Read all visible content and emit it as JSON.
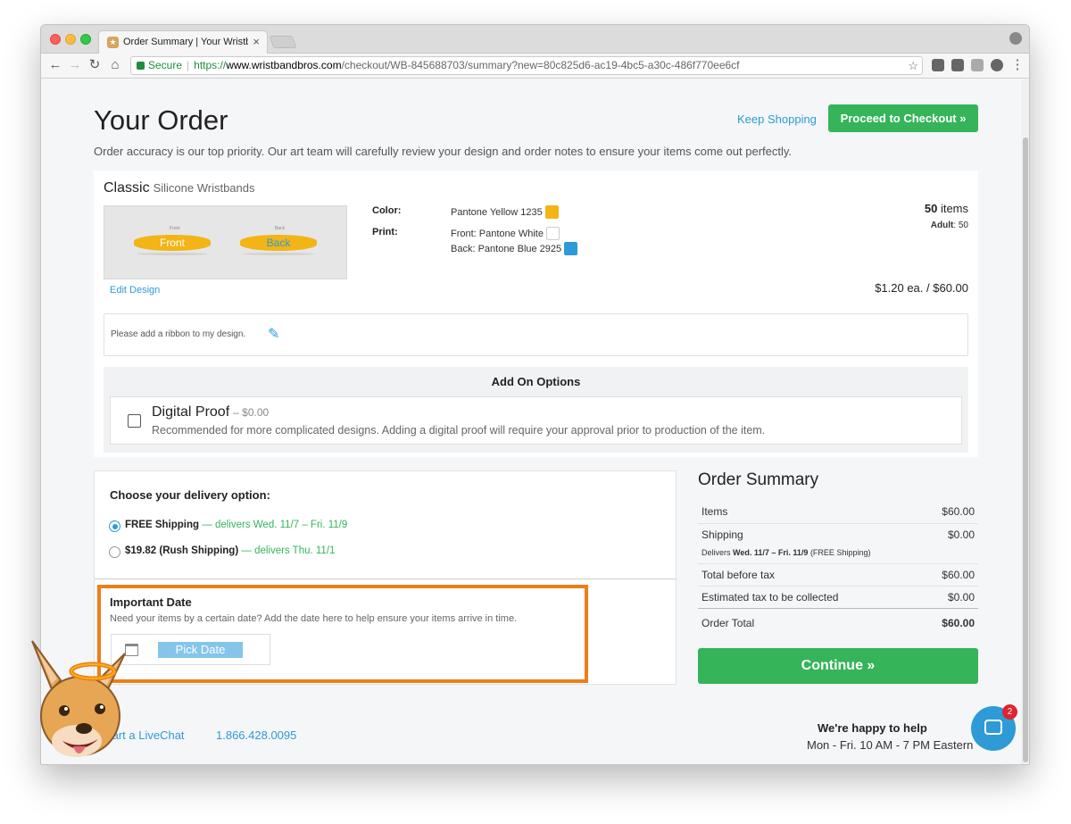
{
  "browser": {
    "tab_title": "Order Summary | Your Wristba",
    "url_secure": "Secure",
    "url_scheme": "https://",
    "url_host": "www.wristbandbros.com",
    "url_path": "/checkout/WB-845688703/summary?new=80c825d6-ac19-4bc5-a30c-486f770ee6cf"
  },
  "header": {
    "title": "Your Order",
    "keep_shopping": "Keep Shopping",
    "proceed": "Proceed to Checkout »",
    "intro": "Order accuracy is our top priority. Our art team will carefully review your design and order notes to ensure your items come out perfectly."
  },
  "product": {
    "name": "Classic",
    "subtitle": "Silicone Wristbands",
    "preview_front": "Front",
    "preview_back": "Back",
    "edit_design": "Edit Design",
    "color_label": "Color:",
    "color_value": "Pantone Yellow 1235",
    "print_label": "Print:",
    "print_front": "Front: Pantone White",
    "print_back": "Back: Pantone Blue 2925",
    "qty_number": "50",
    "qty_unit": "items",
    "adult_label": "Adult",
    "adult_value": ": 50",
    "price": "$1.20 ea. / $60.00",
    "note": "Please add a ribbon to my design."
  },
  "addons": {
    "title": "Add On Options",
    "items": [
      {
        "name": "Digital Proof",
        "price": "– $0.00",
        "description": "Recommended for more complicated designs. Adding a digital proof will require your approval prior to production of the item."
      }
    ]
  },
  "delivery": {
    "title": "Choose your delivery option:",
    "options": [
      {
        "label": "FREE Shipping",
        "detail": "— delivers Wed. 11/7 – Fri. 11/9"
      },
      {
        "label": "$19.82 (Rush Shipping)",
        "detail": "— delivers Thu. 11/1"
      }
    ],
    "important_title": "Important Date",
    "important_desc": "Need your items by a certain date? Add the date here to help ensure your items arrive in time.",
    "pick_date": "Pick Date"
  },
  "summary": {
    "title": "Order Summary",
    "items_label": "Items",
    "items_value": "$60.00",
    "shipping_label": "Shipping",
    "shipping_value": "$0.00",
    "delivers_prefix": "Delivers",
    "delivers_dates": "Wed. 11/7 – Fri. 11/9",
    "delivers_suffix": "(FREE Shipping)",
    "before_tax_label": "Total before tax",
    "before_tax_value": "$60.00",
    "tax_label": "Estimated tax to be collected",
    "tax_value": "$0.00",
    "total_label": "Order Total",
    "total_value": "$60.00",
    "continue": "Continue »"
  },
  "footer": {
    "livechat": "tart a LiveChat",
    "phone": "1.866.428.0095",
    "happy": "We're happy to help",
    "hours": "Mon - Fri. 10 AM - 7 PM Eastern",
    "chat_badge": "2"
  },
  "colors": {
    "accent_green": "#35b45a",
    "link_blue": "#2e9bd6",
    "highlight_orange": "#f07d18",
    "band_yellow": "#f3b416"
  }
}
